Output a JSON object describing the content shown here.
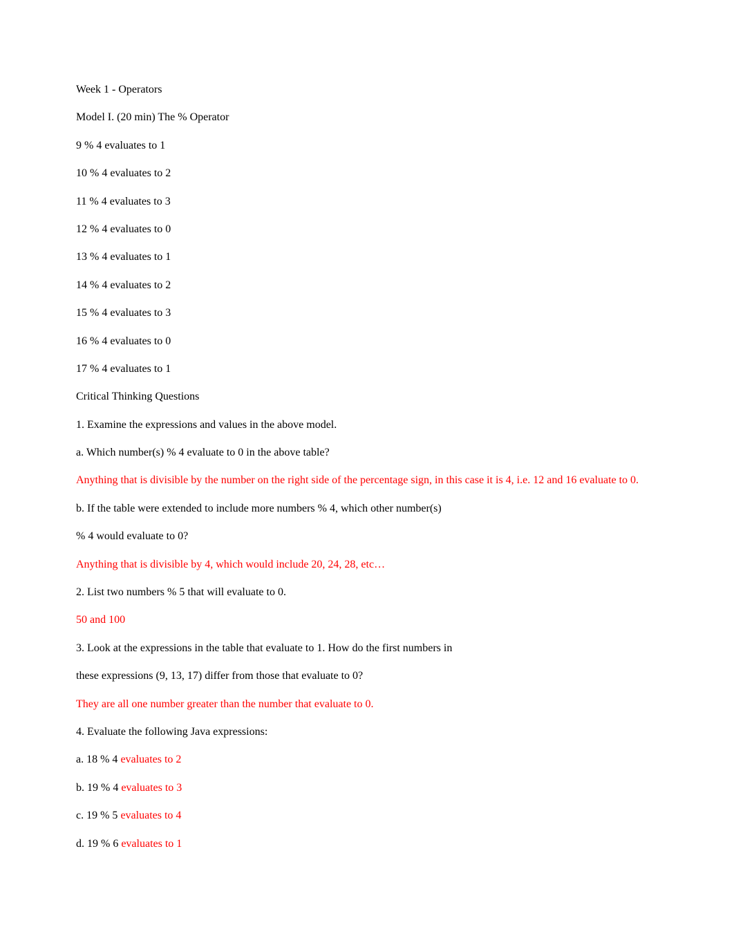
{
  "title": "Week 1 - Operators",
  "model_header": "Model I. (20 min) The % Operator",
  "evaluations": [
    "9 % 4 evaluates to 1",
    "10 % 4 evaluates to 2",
    "11 % 4 evaluates to 3",
    "12 % 4 evaluates to 0",
    "13 % 4 evaluates to 1",
    "14 % 4 evaluates to 2",
    "15 % 4 evaluates to 3",
    "16 % 4 evaluates to 0",
    "17 % 4 evaluates to 1"
  ],
  "ctq_header": "Critical Thinking Questions",
  "q1": "1. Examine the expressions and values in the above model.",
  "q1a": "a. Which number(s) % 4 evaluate to 0 in the above table?",
  "a1a": "Anything that is divisible by the number on the right side of the percentage sign, in this case it is 4, i.e. 12 and 16 evaluate to 0.",
  "q1b": "b. If the table were extended to include more numbers % 4, which other number(s)",
  "q1b_cont": "% 4 would evaluate to 0?",
  "a1b": "Anything that is divisible by 4, which would include 20, 24, 28, etc…",
  "q2": "2. List two numbers % 5 that will evaluate to 0.",
  "a2": "50 and 100",
  "q3": "3. Look at the expressions in the table that evaluate to 1. How do the first numbers in",
  "q3_cont": "these expressions (9, 13, 17) differ from those that evaluate to 0?",
  "a3": "They are all one number greater than the number that evaluate to 0.",
  "q4": "4. Evaluate the following Java expressions:",
  "q4_items": [
    {
      "prompt": "a. 18 % 4 ",
      "ans": "evaluates to 2"
    },
    {
      "prompt": "b. 19 % 4 ",
      "ans": "evaluates to 3"
    },
    {
      "prompt": "c. 19 % 5 ",
      "ans": "evaluates to 4"
    },
    {
      "prompt": "d. 19 % 6 ",
      "ans": "evaluates to 1"
    }
  ]
}
